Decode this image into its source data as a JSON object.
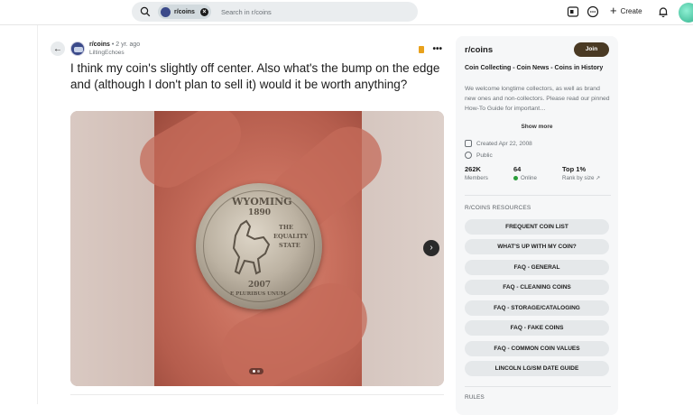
{
  "header": {
    "search_chip": "r/coins",
    "search_placeholder": "Search in r/coins",
    "create_label": "Create",
    "icons": [
      "search-icon",
      "close-icon",
      "ad-icon",
      "chat-icon",
      "plus-icon",
      "bell-icon"
    ]
  },
  "post": {
    "subreddit": "r/coins",
    "age": "• 2 yr. ago",
    "author": "LiltingEchoes",
    "title": "I think my coin's slightly off center. Also what's the bump on the edge and (although I don't plan to sell it) would it be worth anything?",
    "coin_text": {
      "top": "WYOMING",
      "year_top": "1890",
      "motto_1": "THE",
      "motto_2": "EQUALITY",
      "motto_3": "STATE",
      "year_bottom": "2007",
      "bottom": "E PLURIBUS UNUM"
    },
    "gallery": {
      "current": 1,
      "total": 2
    }
  },
  "sidebar": {
    "name": "r/coins",
    "join_label": "Join",
    "desc_title": "Coin Collecting - Coin News - Coins in History",
    "description": "We welcome longtime collectors, as well as brand new ones and non-collectors. Please read our pinned How-To Guide for important…",
    "show_more": "Show more",
    "created": "Created Apr 22, 2008",
    "visibility": "Public",
    "stats": [
      {
        "value": "262K",
        "label": "Members"
      },
      {
        "value": "64",
        "label": "Online"
      },
      {
        "value": "Top 1%",
        "label": "Rank by size"
      }
    ],
    "resources_heading": "R/COINS RESOURCES",
    "resources": [
      "FREQUENT COIN LIST",
      "WHAT'S UP WITH MY COIN?",
      "FAQ - GENERAL",
      "FAQ - CLEANING COINS",
      "FAQ - STORAGE/CATALOGING",
      "FAQ - FAKE COINS",
      "FAQ - COMMON COIN VALUES",
      "LINCOLN LG/SM DATE GUIDE"
    ],
    "rules_heading": "RULES"
  }
}
